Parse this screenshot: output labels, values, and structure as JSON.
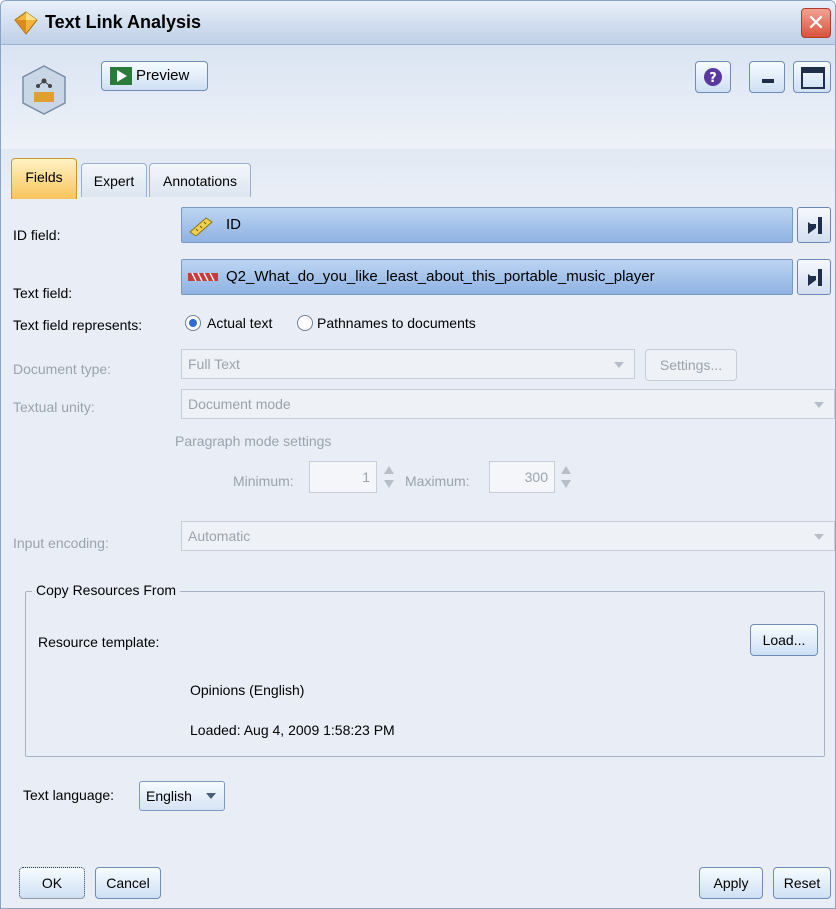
{
  "window": {
    "title": "Text Link Analysis",
    "close_glyph": "✕"
  },
  "toolbar": {
    "preview_label": "Preview",
    "icons": [
      "node-icon",
      "preview-play-icon",
      "help-icon",
      "minimize-icon",
      "maximize-icon"
    ]
  },
  "tabs": [
    {
      "label": "Fields",
      "active": true
    },
    {
      "label": "Expert",
      "active": false
    },
    {
      "label": "Annotations",
      "active": false
    }
  ],
  "fields": {
    "id_label": "ID field:",
    "id_value": "ID",
    "text_label": "Text field:",
    "text_value": "Q2_What_do_you_like_least_about_this_portable_music_player",
    "represents_label": "Text field represents:",
    "represents_options": [
      "Actual text",
      "Pathnames to documents"
    ],
    "represents_selected": "Actual text",
    "doc_type_label": "Document type:",
    "doc_type_value": "Full Text",
    "settings_label": "Settings...",
    "textual_unity_label": "Textual unity:",
    "textual_unity_value": "Document mode",
    "paragraph_title": "Paragraph mode settings",
    "min_label": "Minimum:",
    "min_value": "1",
    "max_label": "Maximum:",
    "max_value": "300",
    "encoding_label": "Input encoding:",
    "encoding_value": "Automatic"
  },
  "resources": {
    "group_title": "Copy Resources From",
    "template_label": "Resource template:",
    "load_label": "Load...",
    "template_name": "Opinions (English)",
    "loaded_text": "Loaded:  Aug 4, 2009 1:58:23 PM"
  },
  "language": {
    "label": "Text language:",
    "value": "English"
  },
  "buttons": {
    "ok": "OK",
    "cancel": "Cancel",
    "apply": "Apply",
    "reset": "Reset"
  },
  "colors": {
    "field_bar": "#8fb3e3",
    "active_tab": "#f8c45a",
    "close": "#d9533c"
  }
}
